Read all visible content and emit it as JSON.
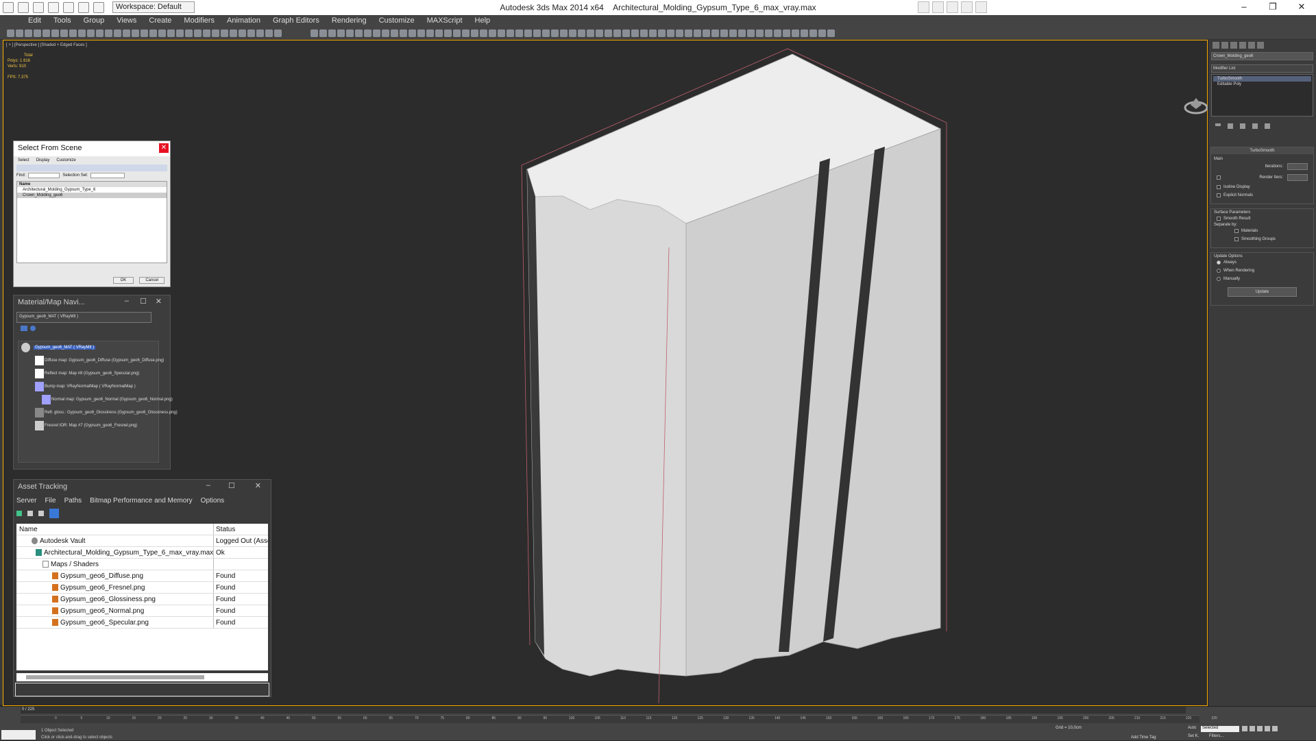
{
  "title": {
    "app": "Autodesk 3ds Max  2014 x64",
    "file": "Architectural_Molding_Gypsum_Type_6_max_vray.max",
    "workspace": "Workspace: Default"
  },
  "menu": [
    "Edit",
    "Tools",
    "Group",
    "Views",
    "Create",
    "Modifiers",
    "Animation",
    "Graph Editors",
    "Rendering",
    "Customize",
    "MAXScript",
    "Help"
  ],
  "viewport": {
    "label": "[ + ] [Perspective ] [Shaded + Edged Faces ]",
    "stats": {
      "total_label": "Total",
      "polys": "Polys:  1 816",
      "verts": "Verts:  910",
      "fps": "FPS:   7.375"
    }
  },
  "select_dialog": {
    "title": "Select From Scene",
    "menu": [
      "Select",
      "Display",
      "Customize"
    ],
    "find_label": "Find:",
    "selection_set_label": "Selection Set:",
    "col_name": "Name",
    "items": [
      "Architectural_Molding_Gypsum_Type_6",
      "Crown_Molding_geo6"
    ],
    "ok": "OK",
    "cancel": "Cancel"
  },
  "material_nav": {
    "title": "Material/Map Navi...",
    "field": "Gypsum_geo6_MAT  ( VRayMtl )",
    "root": "Gypsum_geo6_MAT  ( VRayMtl )",
    "maps": [
      "Diffuse map: Gypsum_geo6_Diffuse (Gypsum_geo6_Diffuse.png)",
      "Reflect map: Map #8 (Gypsum_geo6_Specular.png)",
      "Bump map: VRayNormalMap  ( VRayNormalMap )",
      "Normal map: Gypsum_geo6_Normal (Gypsum_geo6_Normal.png)",
      "Refl. gloss.: Gypsum_geo6_Glossiness (Gypsum_geo6_Glossiness.png)",
      "Fresnel IOR: Map #7 (Gypsum_geo6_Fresnel.png)"
    ]
  },
  "asset_tracking": {
    "title": "Asset Tracking",
    "menu": [
      "Server",
      "File",
      "Paths",
      "Bitmap Performance and Memory",
      "Options"
    ],
    "col_name": "Name",
    "col_status": "Status",
    "rows": [
      {
        "name": "Autodesk Vault",
        "status": "Logged Out (Asset"
      },
      {
        "name": "Architectural_Molding_Gypsum_Type_6_max_vray.max",
        "status": "Ok"
      },
      {
        "name": "Maps / Shaders",
        "status": ""
      },
      {
        "name": "Gypsum_geo6_Diffuse.png",
        "status": "Found"
      },
      {
        "name": "Gypsum_geo6_Fresnel.png",
        "status": "Found"
      },
      {
        "name": "Gypsum_geo6_Glossiness.png",
        "status": "Found"
      },
      {
        "name": "Gypsum_geo6_Normal.png",
        "status": "Found"
      },
      {
        "name": "Gypsum_geo6_Specular.png",
        "status": "Found"
      }
    ]
  },
  "command_panel": {
    "object_name": "Crown_Molding_geo6",
    "modifier_list": "Modifier List",
    "stack": [
      "TurboSmooth",
      "Editable Poly"
    ],
    "rollout": "TurboSmooth",
    "main": "Main",
    "iterations": "Iterations:",
    "render_iters": "Render Iters:",
    "isoline": "Isoline Display",
    "explicit": "Explicit Normals",
    "surface": "Surface Parameters",
    "smooth_result": "Smooth Result",
    "separate_by": "Separate by:",
    "materials": "Materials",
    "smoothing_groups": "Smoothing Groups",
    "update_options": "Update Options",
    "always": "Always",
    "when_rendering": "When Rendering",
    "manually": "Manually",
    "update": "Update"
  },
  "status": {
    "frame": "0 / 225",
    "selected": "1 Object Selected",
    "hint": "Click or click-and-drag to select objects",
    "selected_dd": "Selected",
    "add_time_tag": "Add Time Tag",
    "grid": "Grid = 10,0cm",
    "auto": "Auto",
    "set_k": "Set K.",
    "filters": "Filters..."
  },
  "ticks": [
    "0",
    "5",
    "10",
    "15",
    "20",
    "25",
    "30",
    "35",
    "40",
    "45",
    "50",
    "55",
    "60",
    "65",
    "70",
    "75",
    "80",
    "85",
    "90",
    "95",
    "100",
    "105",
    "110",
    "115",
    "120",
    "125",
    "130",
    "135",
    "140",
    "145",
    "150",
    "155",
    "160",
    "165",
    "170",
    "175",
    "180",
    "185",
    "190",
    "195",
    "200",
    "205",
    "210",
    "215",
    "220",
    "225"
  ]
}
